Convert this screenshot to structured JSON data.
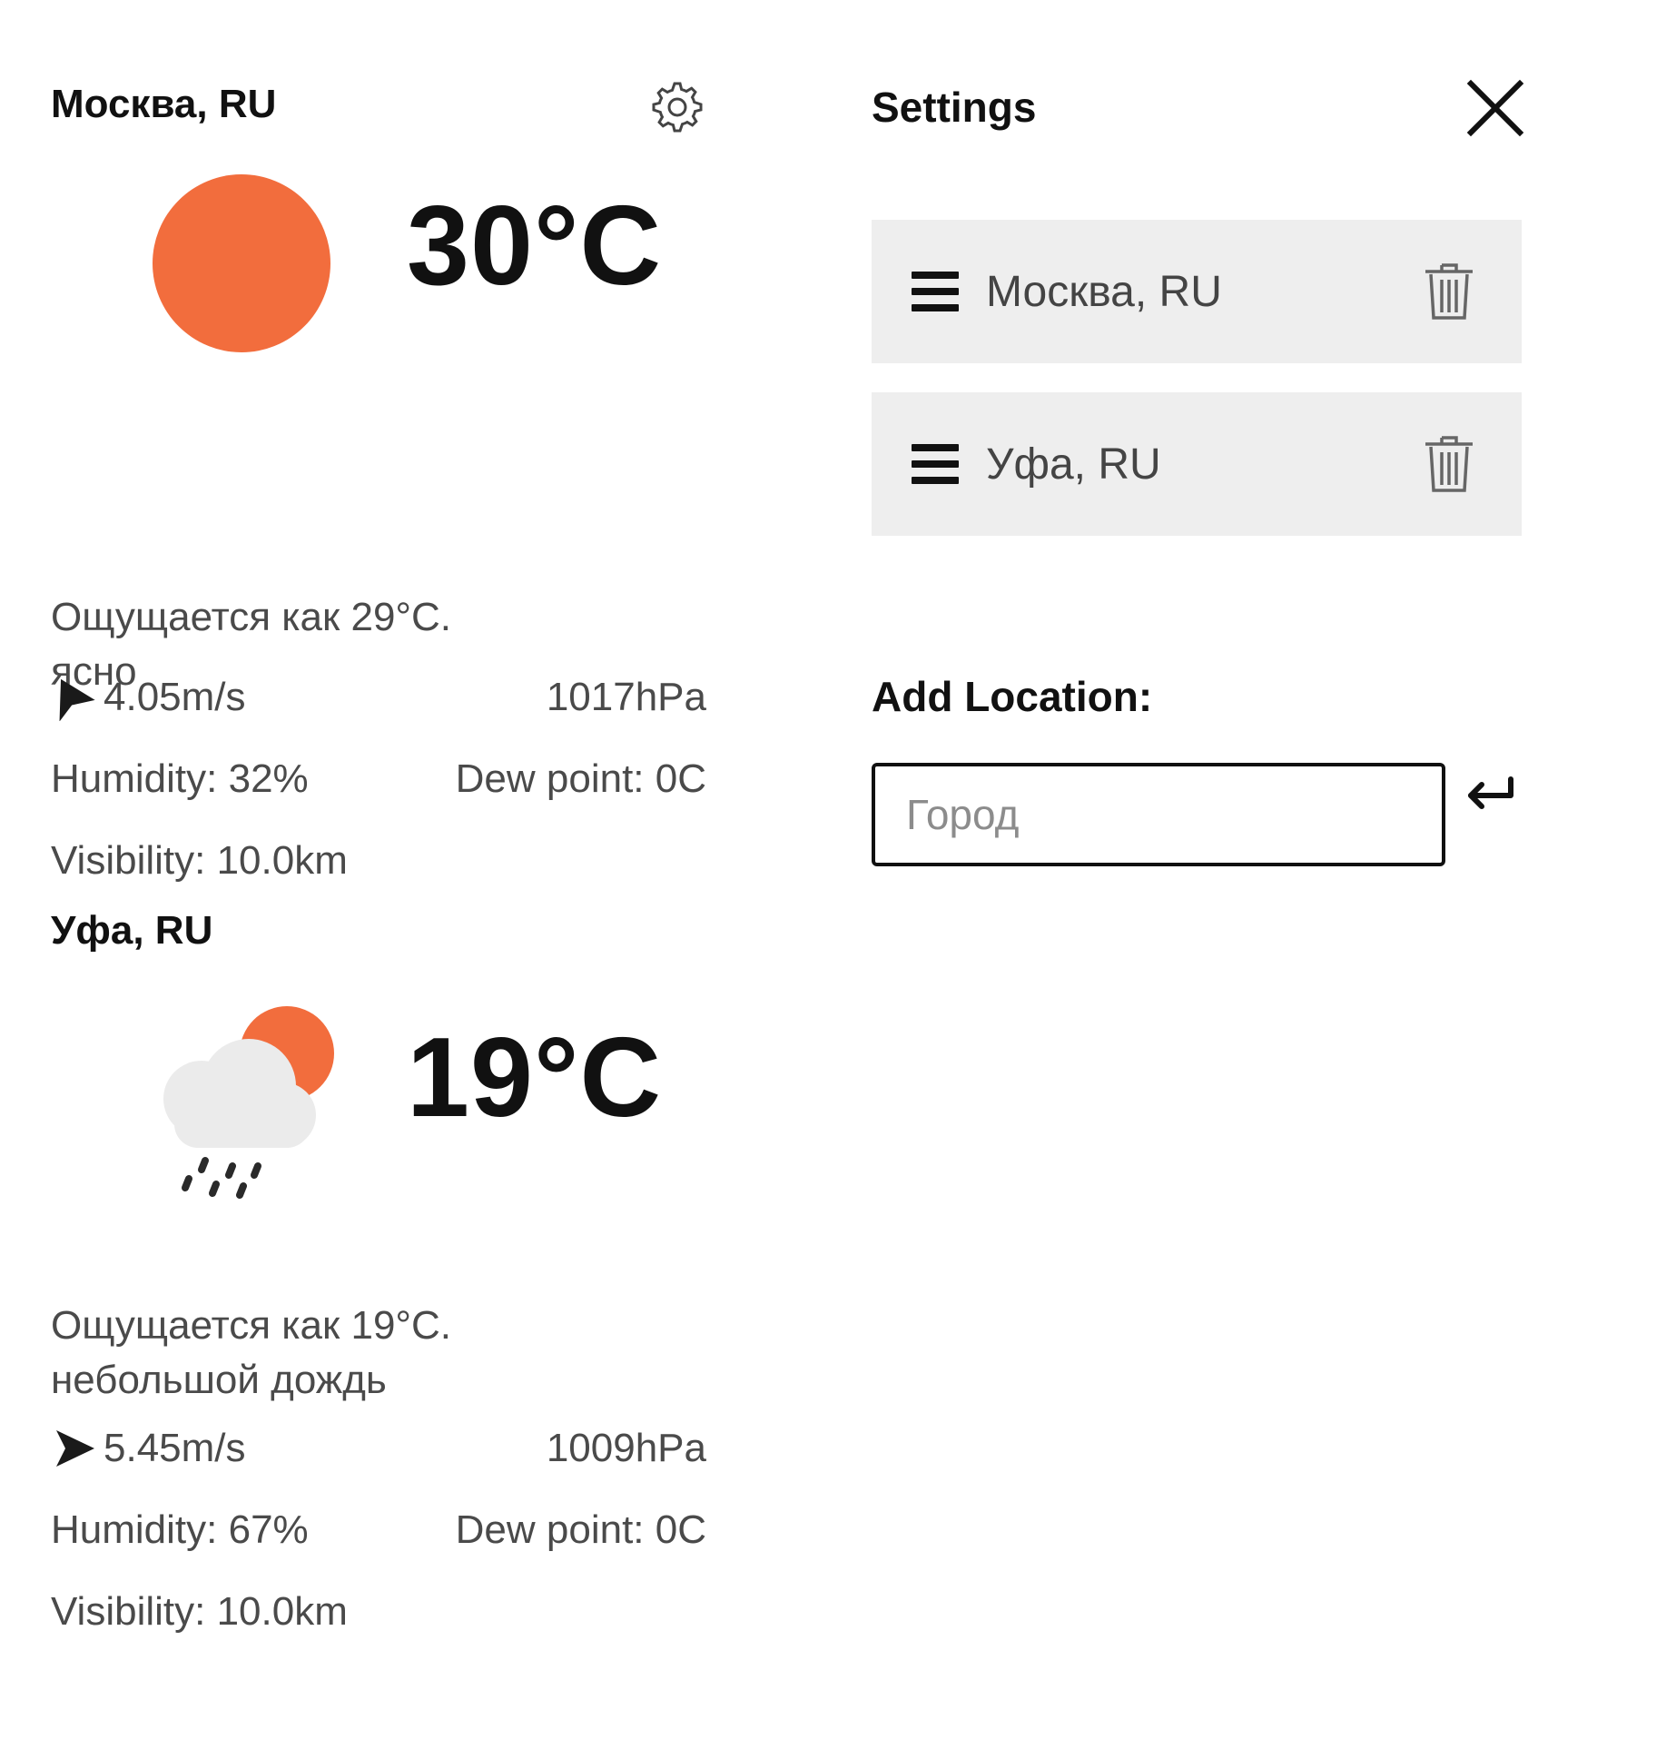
{
  "weather": [
    {
      "city": "Москва, RU",
      "temperature": "30°C",
      "feels": "Ощущается как 29°C. ясно",
      "wind": "4.05m/s",
      "pressure": "1017hPa",
      "humidity": "Humidity: 32%",
      "dew_point": "Dew point: 0C",
      "visibility": "Visibility: 10.0km",
      "icon": "sun-icon"
    },
    {
      "city": "Уфа, RU",
      "temperature": "19°C",
      "feels": "Ощущается как 19°C. небольшой дождь",
      "wind": "5.45m/s",
      "pressure": "1009hPa",
      "humidity": "Humidity: 67%",
      "dew_point": "Dew point: 0C",
      "visibility": "Visibility: 10.0km",
      "icon": "cloud-sun-rain-icon"
    }
  ],
  "settings": {
    "title": "Settings",
    "locations": [
      {
        "name": "Москва, RU"
      },
      {
        "name": "Уфа, RU"
      }
    ],
    "add_label": "Add Location:",
    "input_placeholder": "Город",
    "input_value": ""
  },
  "colors": {
    "sun": "#f26d3d",
    "cloud": "#e8e8e8",
    "rain": "#2a2a2a",
    "list_bg": "#eeeeee",
    "muted_text": "#4a4a4a"
  },
  "icons": {
    "settings": "gear-icon",
    "close": "close-icon",
    "drag": "drag-handle-icon",
    "delete": "trash-icon",
    "submit": "enter-icon",
    "wind": "wind-direction-icon"
  }
}
